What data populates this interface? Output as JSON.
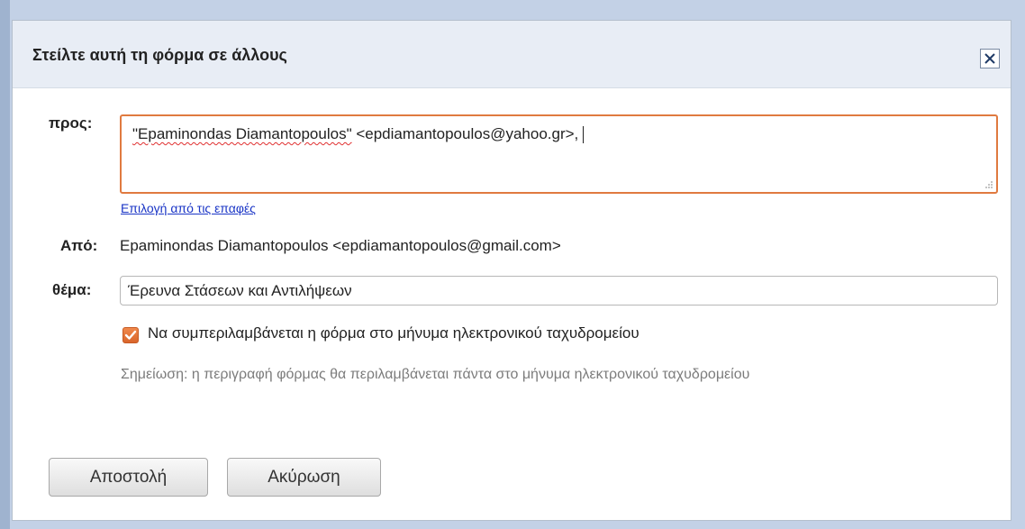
{
  "dialog": {
    "title": "Στείλτε αυτή τη φόρμα σε άλλους",
    "close_icon": "close-icon"
  },
  "to": {
    "label": "προς:",
    "value_name": "\"Epaminondas Diamantopoulos\"",
    "value_email": " <epdiamantopoulos@yahoo.gr>,",
    "resize_icon": "resize-grip-icon"
  },
  "contacts_link": "Επιλογή από τις επαφές",
  "from": {
    "label": "Από:",
    "value": "Epaminondas Diamantopoulos <epdiamantopoulos@gmail.com>"
  },
  "subject": {
    "label": "θέμα:",
    "value": "Έρευνα Στάσεων και Αντιλήψεων"
  },
  "include_form": {
    "checked": true,
    "label": "Να συμπεριλαμβάνεται η φόρμα στο μήνυμα ηλεκτρονικού ταχυδρομείου",
    "icon": "checkmark-icon"
  },
  "note": "Σημείωση: η περιγραφή φόρμας θα περιλαμβάνεται πάντα στο μήνυμα ηλεκτρονικού ταχυδρομείου",
  "buttons": {
    "send": "Αποστολή",
    "cancel": "Ακύρωση"
  },
  "colors": {
    "accent_border": "#e07a40",
    "link": "#1a35c6",
    "title_bar": "#e8edf5"
  }
}
